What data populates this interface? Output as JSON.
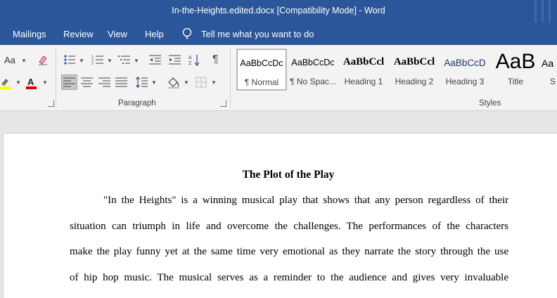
{
  "window": {
    "title": "In-the-Heights.edited.docx [Compatibility Mode]  -  Word"
  },
  "menu": {
    "items": [
      "Mailings",
      "Review",
      "View",
      "Help"
    ],
    "tell_me": "Tell me what you want to do"
  },
  "ribbon": {
    "font": {
      "change_case_label": "Aa"
    },
    "groups": {
      "paragraph": "Paragraph",
      "styles": "Styles"
    },
    "styles": [
      {
        "preview": "AaBbCcDc",
        "name": "¶ Normal"
      },
      {
        "preview": "AaBbCcDc",
        "name": "¶ No Spac..."
      },
      {
        "preview": "AaBbCcl",
        "name": "Heading 1"
      },
      {
        "preview": "AaBbCcl",
        "name": "Heading 2"
      },
      {
        "preview": "AaBbCcD",
        "name": "Heading 3"
      },
      {
        "preview": "AaB",
        "name": "Title"
      },
      {
        "preview": "Aa",
        "name": "S"
      }
    ],
    "colors": {
      "highlight": "#ffff00",
      "font_color": "#e00000"
    }
  },
  "document": {
    "heading": "The Plot of the Play",
    "lines": [
      "\"In the Heights\" is a winning musical play that shows that any person regardless of their",
      "situation can triumph in life and overcome the challenges. The performances of the characters",
      "make the play funny yet at the same time very emotional as they narrate the story through the use",
      "of hip hop music. The musical serves as a reminder to the audience and gives very invaluable"
    ]
  },
  "colors": {
    "accent": "#2b579a"
  }
}
